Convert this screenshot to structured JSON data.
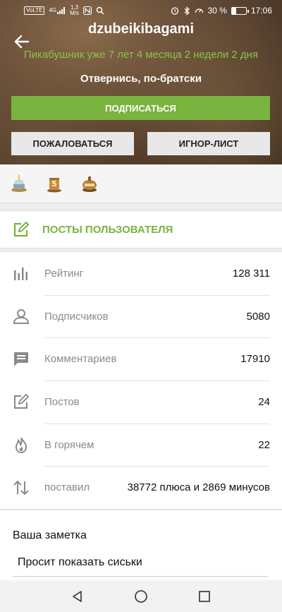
{
  "status_bar": {
    "net_badge": "VoLTE",
    "signal_small": "4G",
    "speed_value": "1,3",
    "speed_unit": "M/s",
    "battery_percent": "30 %",
    "battery_level": 0.3,
    "time": "17:06"
  },
  "profile": {
    "username": "dzubeikibagami",
    "tenure": "Пикабушник уже 7 лет 4 месяца 2 недели 2 дня",
    "subtitle": "Отвернись, по-братски"
  },
  "actions": {
    "subscribe": "ПОДПИСАТЬСЯ",
    "complain": "ПОЖАЛОВАТЬСЯ",
    "ignore": "ИГНОР-ЛИСТ"
  },
  "awards": [
    {
      "icon": "cake-award-icon"
    },
    {
      "icon": "five-years-award-icon"
    },
    {
      "icon": "1000-award-icon"
    }
  ],
  "posts_link": {
    "label": "ПОСТЫ ПОЛЬЗОВАТЕЛЯ"
  },
  "stats": [
    {
      "icon": "rating-icon",
      "label": "Рейтинг",
      "value": "128 311"
    },
    {
      "icon": "person-icon",
      "label": "Подписчиков",
      "value": "5080"
    },
    {
      "icon": "comment-icon",
      "label": "Комментариев",
      "value": "17910"
    },
    {
      "icon": "edit-icon",
      "label": "Постов",
      "value": "24"
    },
    {
      "icon": "flame-icon",
      "label": "В горячем",
      "value": "22"
    },
    {
      "icon": "arrows-updown-icon",
      "label": "поставил",
      "value": "38772 плюса и 2869 минусов"
    }
  ],
  "note": {
    "title": "Ваша заметка",
    "value": "Просит показать сиськи"
  },
  "colors": {
    "accent": "#79b43e",
    "tenure_green": "#8bc34a"
  }
}
